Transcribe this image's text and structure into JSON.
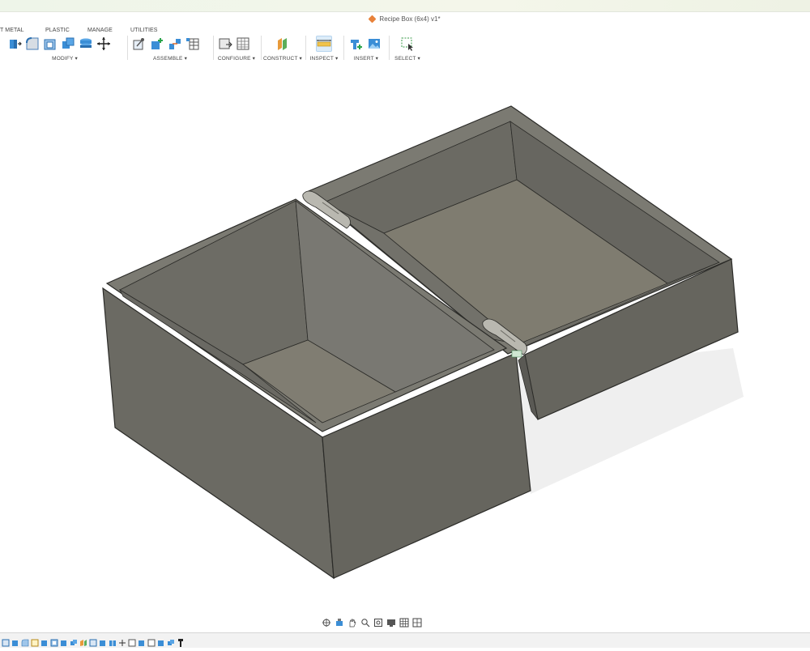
{
  "title_bar": {
    "document_title": "Recipe Box (6x4) v1*",
    "doc_icon": "orange-cube-icon"
  },
  "toolbar": {
    "tabs": [
      "T METAL",
      "PLASTIC",
      "MANAGE",
      "UTILITIES"
    ],
    "groups": {
      "modify": "MODIFY ▾",
      "assemble": "ASSEMBLE ▾",
      "configure": "CONFIGURE ▾",
      "construct": "CONSTRUCT ▾",
      "inspect": "INSPECT ▾",
      "insert": "INSERT ▾",
      "select": "SELECT ▾"
    },
    "active_group": "inspect",
    "accent_color": "#0696d7"
  },
  "viewport": {
    "model": "open recipe box with hinged lid",
    "model_color": "#6e6d66",
    "shadow_color": "#ededed"
  },
  "nav_bar": {
    "icons": [
      "orbit-icon",
      "look-at-icon",
      "pan-hand-icon",
      "zoom-icon",
      "fit-icon",
      "display-mode-icon",
      "grid-icon",
      "viewports-icon"
    ]
  },
  "timeline": {
    "feature_count": 19
  }
}
